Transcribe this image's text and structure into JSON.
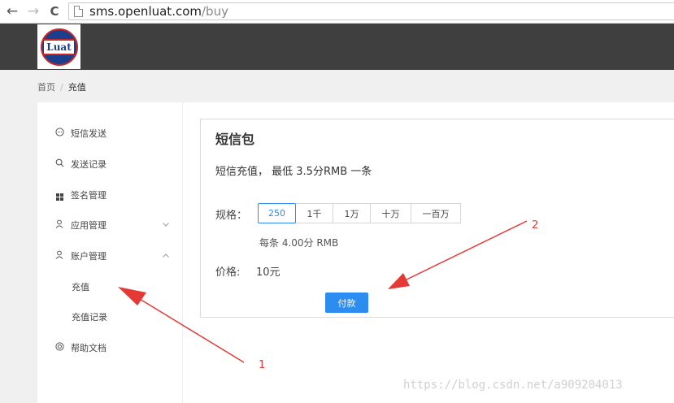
{
  "browser": {
    "back_glyph": "←",
    "forward_glyph": "→",
    "reload_glyph": "C",
    "url_host": "sms.openluat.com",
    "url_path": "/buy"
  },
  "header": {
    "logo_text": "Luat"
  },
  "breadcrumb": {
    "home": "首页",
    "separator": "/",
    "current": "充值"
  },
  "sidebar": {
    "items": [
      {
        "label": "短信发送",
        "icon": "chat-bubble-icon"
      },
      {
        "label": "发送记录",
        "icon": "search-icon"
      },
      {
        "label": "签名管理",
        "icon": "grid-icon"
      },
      {
        "label": "应用管理",
        "icon": "user-icon",
        "caret": "chevron-down-icon"
      },
      {
        "label": "账户管理",
        "icon": "user-icon",
        "caret": "chevron-up-icon"
      },
      {
        "label": "帮助文档",
        "icon": "help-circle-icon"
      }
    ],
    "sub_items": [
      {
        "label": "充值"
      },
      {
        "label": "充值记录"
      }
    ]
  },
  "panel": {
    "title": "短信包",
    "description": "短信充值， 最低 3.5分RMB 一条",
    "spec_label": "规格：",
    "spec_options": [
      "250",
      "1千",
      "1万",
      "十万",
      "一百万"
    ],
    "spec_selected": "250",
    "unit_price": "每条 4.00分 RMB",
    "price_label": "价格:",
    "price_value": "10元",
    "pay_button": "付款"
  },
  "annotations": {
    "arrow_1": "1",
    "arrow_2": "2",
    "color": "#e53935"
  },
  "watermark": "https://blog.csdn.net/a909204013",
  "colors": {
    "accent": "#2d8cf0",
    "header_bg": "#3f3f3f",
    "page_bg": "#f0f0f0"
  }
}
